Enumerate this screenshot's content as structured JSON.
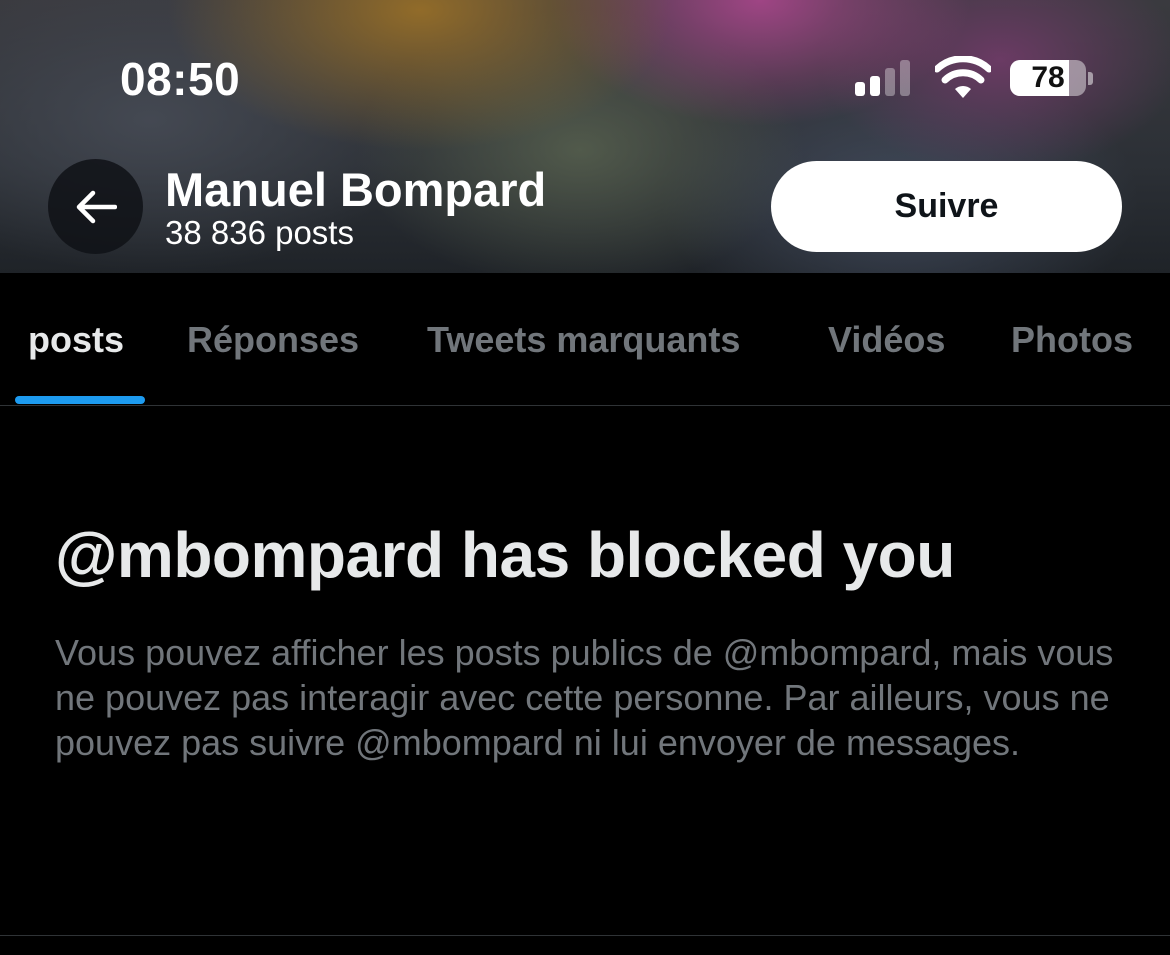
{
  "status_bar": {
    "time": "08:50",
    "battery_percent": "78",
    "icons": [
      "cellular-signal-icon",
      "wifi-icon",
      "battery-icon"
    ]
  },
  "profile": {
    "name": "Manuel Bompard",
    "post_count": "38 836 posts",
    "follow_label": "Suivre",
    "back_icon": "arrow-left-icon"
  },
  "tabs": [
    {
      "label": "posts",
      "active": true
    },
    {
      "label": "Réponses",
      "active": false
    },
    {
      "label": "Tweets marquants",
      "active": false
    },
    {
      "label": "Vidéos",
      "active": false
    },
    {
      "label": "Photos",
      "active": false
    }
  ],
  "blocked": {
    "title": "@mbompard has blocked you",
    "description": "Vous pouvez afficher les posts publics de @mbompard, mais vous ne pouvez pas interagir avec cette personne. Par ailleurs, vous ne pouvez pas suivre @mbompard ni lui envoyer de messages."
  },
  "colors": {
    "background": "#000000",
    "accent": "#1d9bf0",
    "text_primary": "#e7e9ea",
    "text_secondary": "#71767b",
    "follow_button_bg": "#ffffff"
  }
}
